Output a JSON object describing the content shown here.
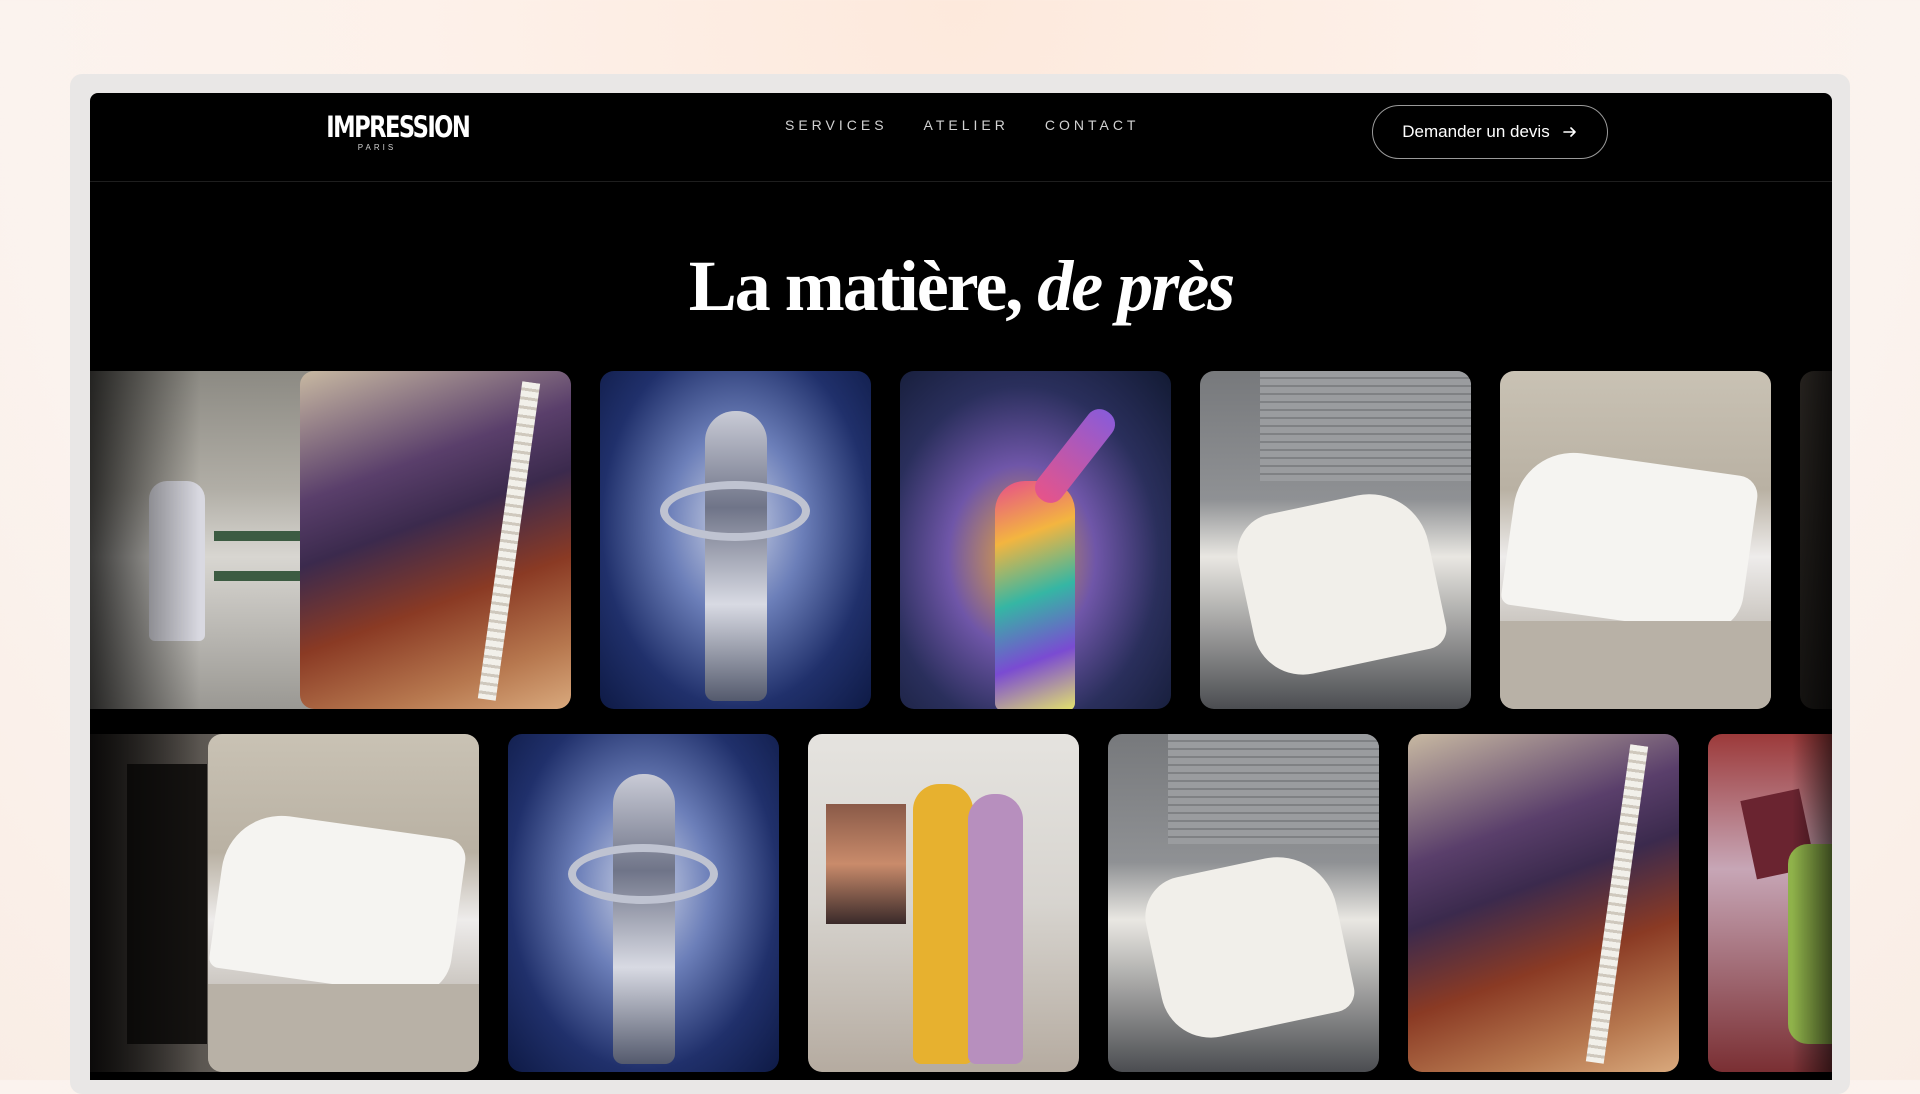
{
  "brand": {
    "name": "IMPRESSION",
    "city": "PARIS"
  },
  "nav": {
    "items": [
      "SERVICES",
      "ATELIER",
      "CONTACT"
    ]
  },
  "cta": {
    "label": "Demander un devis",
    "icon": "arrow-right-icon"
  },
  "hero": {
    "title_regular": "La matière,",
    "title_italic": "de près"
  },
  "gallery": {
    "row1": [
      "bench-photo",
      "fabric-photo",
      "stage-photo",
      "singer-photo",
      "scooter-photo",
      "statue-photo",
      "dark-photo"
    ],
    "row2": [
      "doorway-photo",
      "statue-photo",
      "stage-photo",
      "art-photo",
      "scooter-photo",
      "fabric-photo",
      "cards-photo"
    ]
  },
  "colors": {
    "background": "#000000",
    "text": "#ffffff",
    "frame": "#e9e7e6"
  }
}
